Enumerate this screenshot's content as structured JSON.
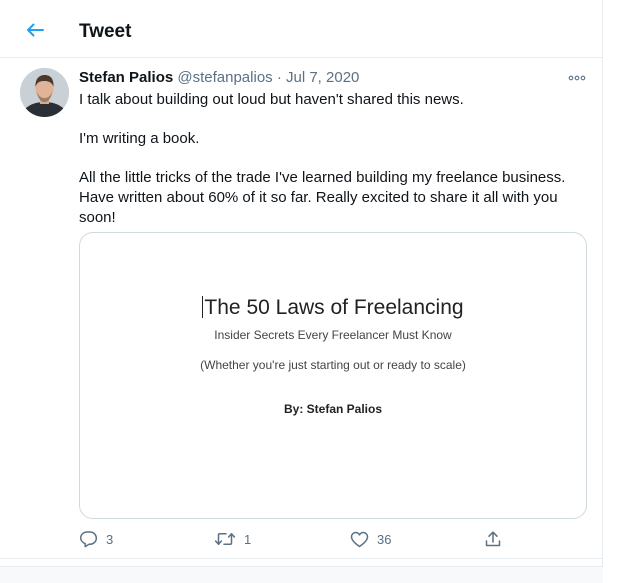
{
  "header": {
    "title": "Tweet"
  },
  "tweet": {
    "author_name": "Stefan Palios",
    "author_handle": "@stefanpalios",
    "separator": "·",
    "date": "Jul 7, 2020",
    "paragraphs": [
      "I talk about building out loud but haven't shared this news.",
      "I'm writing a book.",
      "All the little tricks of the trade I've learned building my freelance business. Have written about 60% of it so far. Really excited to share it all with you soon!"
    ]
  },
  "card": {
    "title": "The 50 Laws of Freelancing",
    "subtitle": "Insider Secrets Every Freelancer Must Know",
    "tagline": "(Whether you're just starting out or ready to scale)",
    "author_line": "By: Stefan Palios"
  },
  "actions": {
    "replies": "3",
    "retweets": "1",
    "likes": "36"
  },
  "colors": {
    "accent": "#1da1f2",
    "secondary_text": "#5b7083",
    "border": "#e6ecf0"
  }
}
